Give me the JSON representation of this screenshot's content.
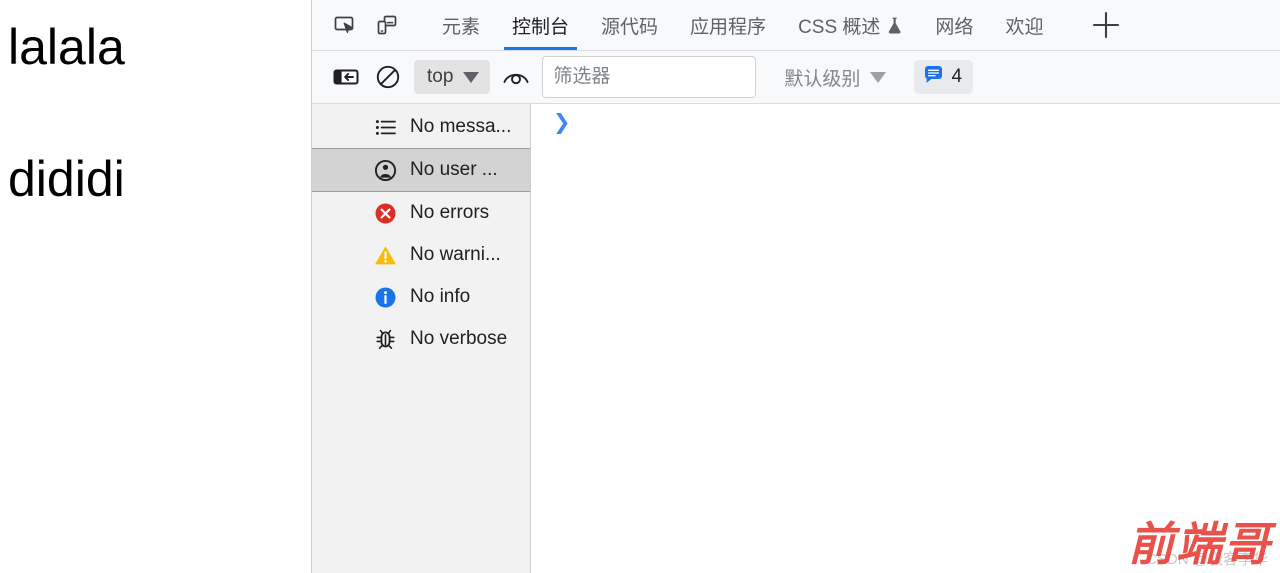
{
  "page": {
    "line1": "lalala",
    "line2": "dididi"
  },
  "tabstrip": {
    "inspect_icon": "inspect-element-icon",
    "device_icon": "device-toolbar-icon",
    "add_label": "+",
    "tabs": [
      {
        "label": "元素",
        "active": false,
        "icon": null
      },
      {
        "label": "控制台",
        "active": true,
        "icon": null
      },
      {
        "label": "源代码",
        "active": false,
        "icon": null
      },
      {
        "label": "应用程序",
        "active": false,
        "icon": null
      },
      {
        "label": "CSS 概述",
        "active": false,
        "icon": "flask-icon"
      },
      {
        "label": "网络",
        "active": false,
        "icon": null
      },
      {
        "label": "欢迎",
        "active": false,
        "icon": null
      }
    ]
  },
  "console_toolbar": {
    "sidebar_toggle_icon": "show-console-sidebar-icon",
    "clear_icon": "clear-console-icon",
    "context_value": "top",
    "eye_icon": "live-expression-icon",
    "filter_placeholder": "筛选器",
    "filter_value": "",
    "level_value": "默认级别",
    "message_count": "4",
    "message_icon": "message-bubble-icon"
  },
  "console_sidebar": {
    "items": [
      {
        "label": "No messa...",
        "icon": "list-icon",
        "selected": false
      },
      {
        "label": "No user ...",
        "icon": "user-message-icon",
        "selected": true
      },
      {
        "label": "No errors",
        "icon": "error-icon",
        "selected": false
      },
      {
        "label": "No warni...",
        "icon": "warning-icon",
        "selected": false
      },
      {
        "label": "No info",
        "icon": "info-icon",
        "selected": false
      },
      {
        "label": "No verbose",
        "icon": "bug-icon",
        "selected": false
      }
    ]
  },
  "console_output": {
    "prompt_chevron": "❯"
  },
  "watermark": {
    "logo": "前端哥",
    "credit": "CSDN @极客李华"
  },
  "colors": {
    "accent_blue": "#1a73e8",
    "error_red": "#d93025",
    "warning_orange": "#fbbc04",
    "info_blue": "#1a73e8",
    "watermark_red": "#e8433c"
  }
}
